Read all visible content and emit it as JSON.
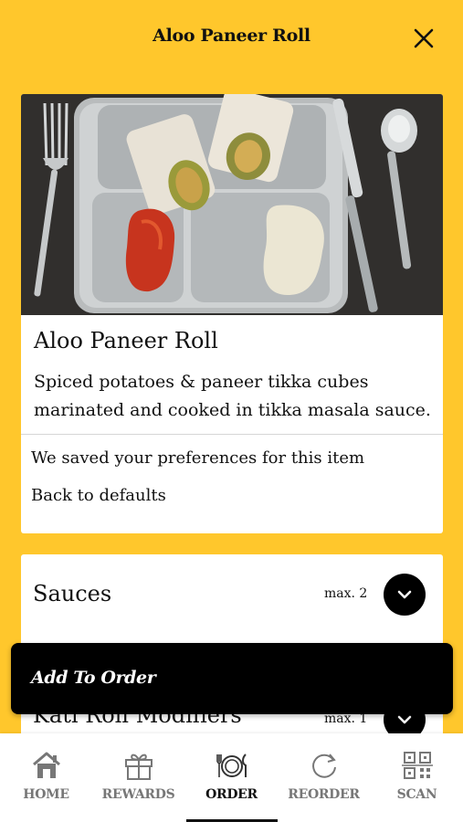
{
  "header": {
    "title": "Aloo Paneer Roll"
  },
  "item": {
    "name": "Aloo Paneer Roll",
    "description": "Spiced potatoes & paneer tikka cubes marinated and cooked in tikka masala sauce.",
    "prefs_note": "We saved your preferences for this item",
    "defaults_link": "Back to defaults"
  },
  "options": [
    {
      "label": "Sauces",
      "max": "max. 2"
    },
    {
      "label": "Kati Roll Modifiers",
      "max": "max. 1"
    }
  ],
  "cta": {
    "label": "Add To Order"
  },
  "nav": {
    "items": [
      {
        "label": "HOME",
        "icon": "home-icon"
      },
      {
        "label": "REWARDS",
        "icon": "gift-icon"
      },
      {
        "label": "ORDER",
        "icon": "plate-cutlery-icon"
      },
      {
        "label": "REORDER",
        "icon": "refresh-icon"
      },
      {
        "label": "SCAN",
        "icon": "qr-code-icon"
      }
    ],
    "active": "ORDER"
  },
  "colors": {
    "brand": "#FFC72C",
    "dark": "#000000",
    "muted": "#777777"
  }
}
